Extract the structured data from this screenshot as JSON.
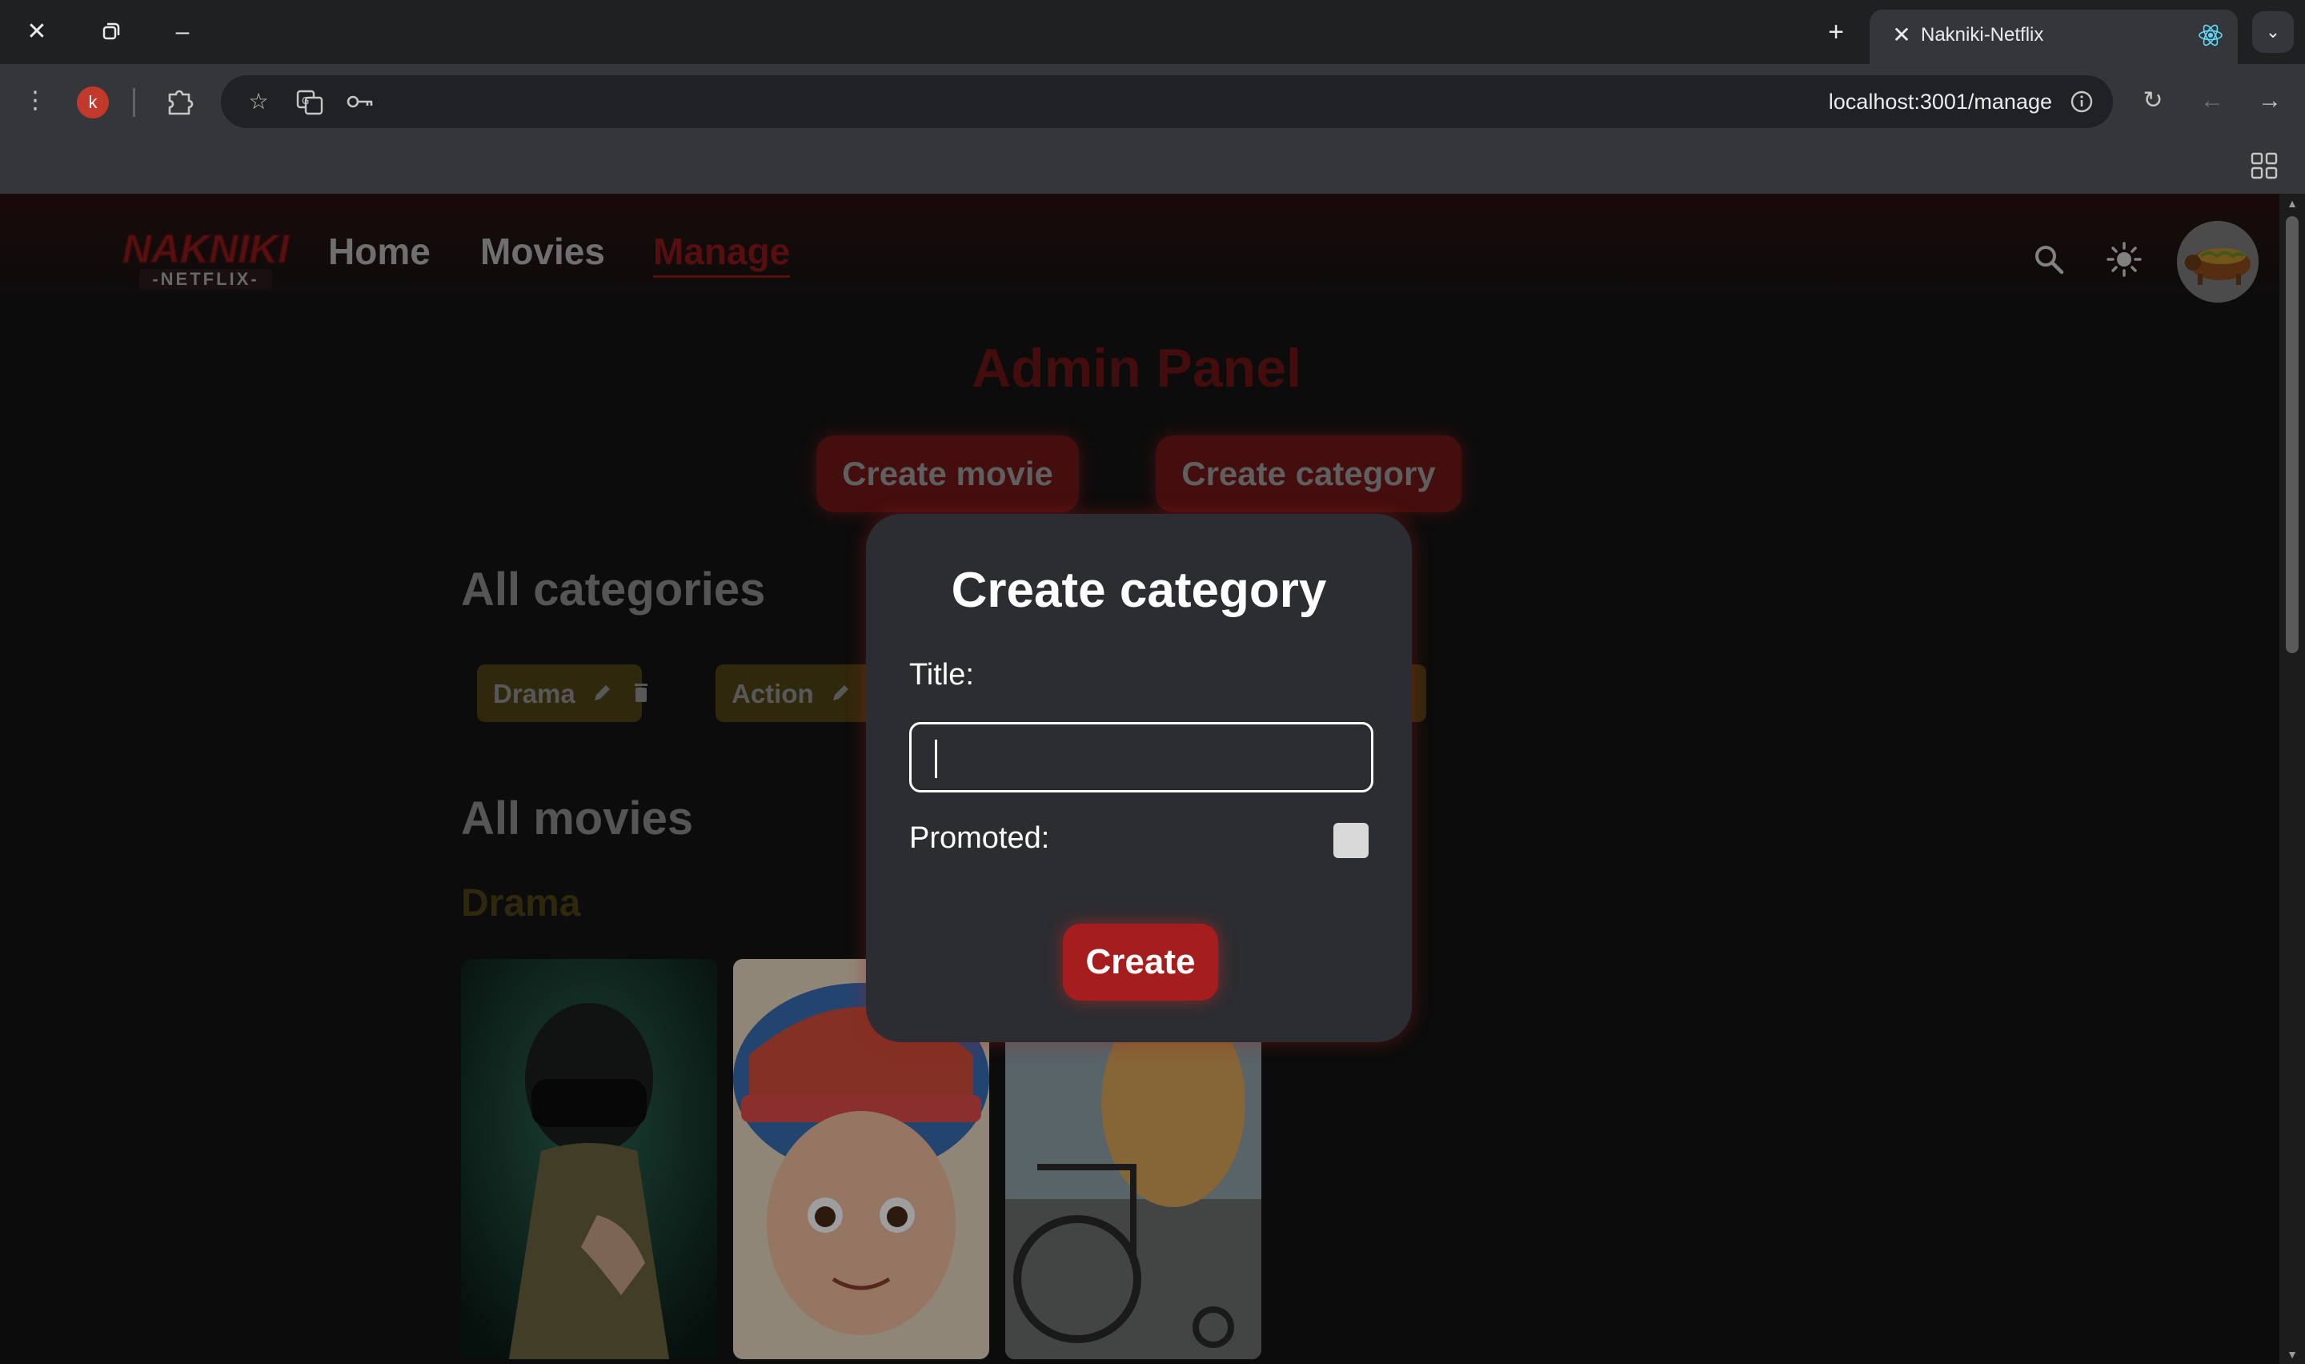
{
  "browser": {
    "tab_title": "Nakniki-Netflix",
    "url": "localhost:3001/manage",
    "profile_initial": "k"
  },
  "site": {
    "logo_text": "NAKNIKI",
    "logo_sub": "NETFLIX",
    "nav": {
      "home": "Home",
      "movies": "Movies",
      "manage": "Manage"
    }
  },
  "admin": {
    "title": "Admin Panel",
    "create_movie": "Create movie",
    "create_category": "Create category"
  },
  "categories": {
    "heading": "All categories",
    "items": [
      {
        "label": "Drama"
      },
      {
        "label": "Action"
      }
    ]
  },
  "movies": {
    "heading": "All movies",
    "category": "Drama"
  },
  "modal": {
    "title": "Create category",
    "title_label": "Title:",
    "title_value": "",
    "promoted_label": "Promoted:",
    "promoted_checked": false,
    "submit": "Create"
  },
  "colors": {
    "accent_red": "#a51d1d",
    "chip_gold": "#4e4214",
    "background": "#141414"
  }
}
